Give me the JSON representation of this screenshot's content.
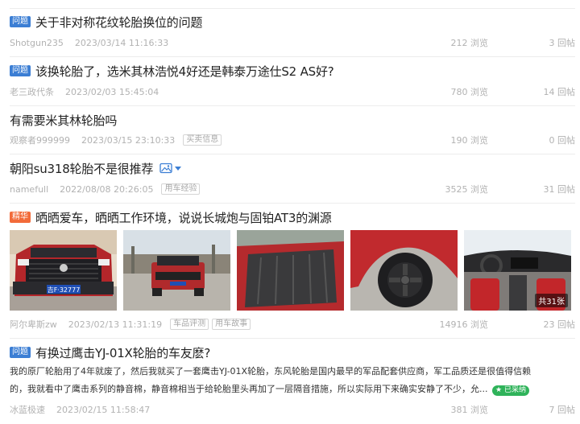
{
  "posts": [
    {
      "badge": "问题",
      "title": "关于非对称花纹轮胎换位的问题",
      "user": "Shotgun235",
      "date": "2023/03/14 11:16:33",
      "views": "212 浏览",
      "replies": "3 回帖"
    },
    {
      "badge": "问题",
      "title": "该换轮胎了，选米其林浩悦4好还是韩泰万途仕S2 AS好?",
      "user": "老三政代条",
      "date": "2023/02/03 15:45:04",
      "views": "780 浏览",
      "replies": "14 回帖"
    },
    {
      "title": "有需要米其林轮胎吗",
      "user": "观察者999999",
      "date": "2023/03/15 23:10:33",
      "tags": [
        "买卖信息"
      ],
      "views": "190 浏览",
      "replies": "0 回帖"
    },
    {
      "title": "朝阳su318轮胎不是很推荐",
      "user": "namefull",
      "date": "2022/08/08 20:26:05",
      "tags": [
        "用车经验"
      ],
      "views": "3525 浏览",
      "replies": "31 回帖"
    },
    {
      "badge": "精华",
      "title": "晒晒爱车，晒晒工作环境，说说长城炮与固铂AT3的渊源",
      "image_count_label": "共31张",
      "plate_text": "吉F·32777",
      "user": "阿尔卑斯zw",
      "date": "2023/02/13 11:31:19",
      "tags": [
        "车品评测",
        "用车故事"
      ],
      "views": "14916 浏览",
      "replies": "23 回帖"
    },
    {
      "badge": "问题",
      "title": "有换过鹰击YJ-01X轮胎的车友麽?",
      "excerpt_line1": "我的原厂轮胎用了4年就废了，然后我就买了一套鹰击YJ-01X轮胎，东风轮胎是国内最早的军品配套供应商，军工品质还是很值得信赖",
      "excerpt_line2": "的，我就看中了鹰击系列的静音棉，静音棉相当于给轮胎里头再加了一层隔音措施，所以实际用下来确实安静了不少，允...",
      "adopted_label": "已采纳",
      "user": "冰蓝极速",
      "date": "2023/02/15 11:58:47",
      "views": "381 浏览",
      "replies": "7 回帖"
    }
  ]
}
